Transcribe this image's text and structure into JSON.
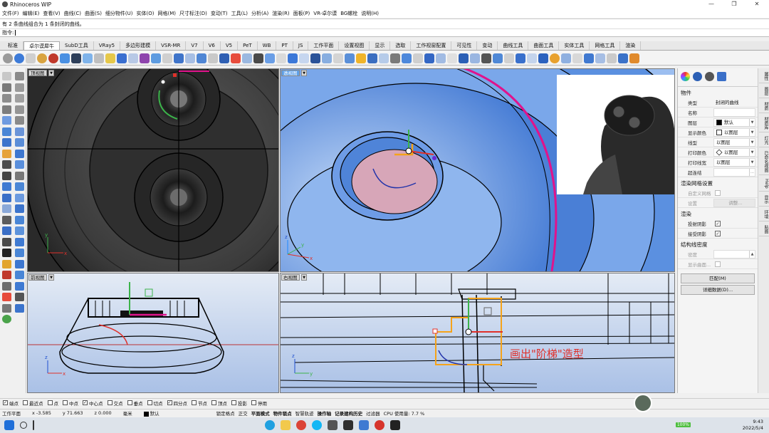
{
  "window": {
    "title": "Rhinoceros WIP",
    "controls": [
      "—",
      "❐",
      "✕"
    ]
  },
  "menu": [
    "文件(F)",
    "编辑(E)",
    "查看(V)",
    "曲线(C)",
    "曲面(S)",
    "细分物件(U)",
    "实体(O)",
    "网格(M)",
    "尺寸标注(D)",
    "变动(T)",
    "工具(L)",
    "分析(A)",
    "渲染(R)",
    "面板(P)",
    "VR-卓尔谟",
    "BG螺栓",
    "说明(H)"
  ],
  "command": {
    "history": "有 2 条曲线组合为 1 条封闭的曲线。",
    "prompt": "指令:"
  },
  "tabs": [
    "标准",
    "卓尔谟犀牛",
    "SubD工具",
    "VRay5",
    "多边形建模",
    "VSR-MR",
    "V7",
    "V6",
    "V5",
    "PeT",
    "WB",
    "PT",
    "JS",
    "工作平面",
    "设置视图",
    "显示",
    "选取",
    "工作视窗配置",
    "可见性",
    "变动",
    "曲线工具",
    "曲面工具",
    "实体工具",
    "网格工具",
    "渲染"
  ],
  "active_tab_index": 1,
  "viewports": {
    "top": {
      "label": "顶视图"
    },
    "perspective": {
      "label": "透视图"
    },
    "front": {
      "label": "前视图"
    },
    "right": {
      "label": "右视图"
    }
  },
  "annotation": "画出\"阶梯\"造型",
  "axes": {
    "x": "x",
    "y": "y",
    "z": "z"
  },
  "properties": {
    "section_object": "物件",
    "rows": [
      {
        "key": "类型",
        "value": "封闭的曲线",
        "swatch": "",
        "dropdown": false
      },
      {
        "key": "名称",
        "value": "",
        "swatch": "",
        "dropdown": false
      },
      {
        "key": "图层",
        "value": "默认",
        "swatch": "#000000",
        "dropdown": true
      },
      {
        "key": "显示颜色",
        "value": "以图层",
        "swatch": "#ffffff",
        "dropdown": true
      },
      {
        "key": "线型",
        "value": "以图层",
        "swatch": "",
        "dropdown": true
      },
      {
        "key": "打印颜色",
        "value": "以图层",
        "swatch": "diamond",
        "dropdown": true
      },
      {
        "key": "打印线宽",
        "value": "以图层",
        "swatch": "",
        "dropdown": true
      },
      {
        "key": "超连结",
        "value": "",
        "swatch": "",
        "dropdown": false
      }
    ],
    "section_mesh": "渲染网格设置",
    "custom_mesh": "自定义网格",
    "settings": "设置",
    "adjust_button": "调整...",
    "section_render": "渲染",
    "cast_shadows": "投射阴影",
    "receive_shadows": "接受阴影",
    "section_isocurve": "结构线密度",
    "density": "密度",
    "show_surface": "显示曲面...",
    "match_button": "匹配(M)",
    "details_button": "详细数据(D)..."
  },
  "side_tabs": [
    "属性",
    "图层",
    "材质",
    "材质库",
    "灯光",
    "已命名视图",
    "Help",
    "显示",
    "环境",
    "贴图"
  ],
  "osnaps": [
    {
      "label": "端点",
      "checked": true
    },
    {
      "label": "最近点",
      "checked": false
    },
    {
      "label": "点",
      "checked": false
    },
    {
      "label": "中点",
      "checked": false
    },
    {
      "label": "中心点",
      "checked": true
    },
    {
      "label": "交点",
      "checked": false
    },
    {
      "label": "垂点",
      "checked": false
    },
    {
      "label": "切点",
      "checked": false
    },
    {
      "label": "四分点",
      "checked": true
    },
    {
      "label": "节点",
      "checked": false
    },
    {
      "label": "顶点",
      "checked": false
    },
    {
      "label": "投影",
      "checked": false
    },
    {
      "label": "停用",
      "checked": false
    }
  ],
  "status": {
    "cplane": "工作平面",
    "x": "x -3.585",
    "y": "y 71.663",
    "z": "z 0.000",
    "unit": "毫米",
    "layer": "默认",
    "panes": [
      "锁定格点",
      "正交",
      "平面模式",
      "物件锁点",
      "智慧轨迹",
      "操作轴",
      "记录建构历史",
      "过滤器"
    ],
    "bold_panes": [
      "平面模式",
      "物件锁点",
      "操作轴",
      "记录建构历史"
    ],
    "cpu": "CPU 使用量: 7.7 %"
  },
  "taskbar": {
    "time": "9:43",
    "date": "2022/5/4",
    "battery": "100%"
  },
  "colors": {
    "viewport_bg": "#b9cbe8",
    "annotation_red": "#e0302a",
    "selection_orange": "#f5a31a",
    "accent_pink": "#e0138c"
  }
}
